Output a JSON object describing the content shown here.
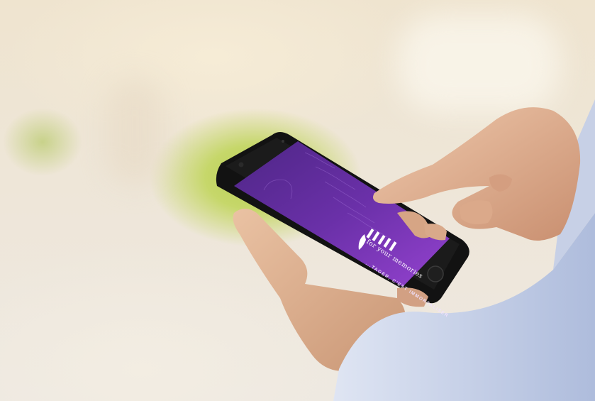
{
  "app": {
    "brand_text": "for your memories",
    "tagline": "...TAGER, C'EST IMMORTALISER"
  },
  "colors": {
    "screen_top": "#5a2a8e",
    "screen_bottom": "#8a3cc8",
    "phone_body": "#141414",
    "sleeve": "#c9d3ea",
    "skin": "#e0b494",
    "foliage": "#bcd159"
  }
}
